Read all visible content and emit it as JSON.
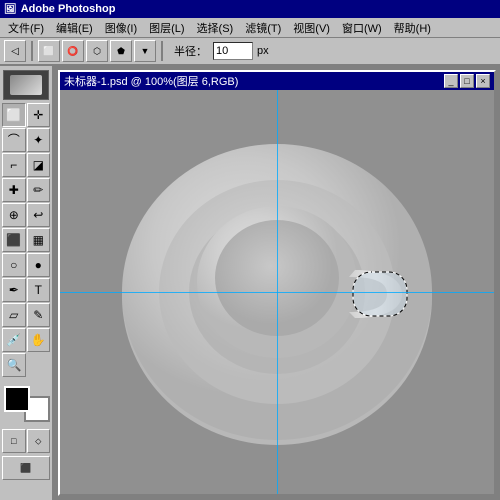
{
  "app": {
    "title": "Adobe Photoshop",
    "icon": "PS"
  },
  "menu": {
    "items": [
      "文件(F)",
      "编辑(E)",
      "图像(I)",
      "图层(L)",
      "选择(S)",
      "滤镜(T)",
      "视图(V)",
      "窗口(W)",
      "帮助(H)"
    ]
  },
  "toolbar": {
    "radius_label": "半径：",
    "radius_value": "10",
    "radius_unit": "px"
  },
  "document": {
    "title": "未标器-1.psd @ 100%(图层 6,RGB)",
    "controls": [
      "_",
      "□",
      "×"
    ]
  },
  "toolbox": {
    "tools": [
      {
        "name": "marquee",
        "icon": "⬜",
        "active": true
      },
      {
        "name": "move",
        "icon": "✛"
      },
      {
        "name": "lasso",
        "icon": "⌒"
      },
      {
        "name": "magic-wand",
        "icon": "✦"
      },
      {
        "name": "crop",
        "icon": "⌐"
      },
      {
        "name": "slice",
        "icon": "⊿"
      },
      {
        "name": "heal",
        "icon": "✚"
      },
      {
        "name": "brush",
        "icon": "✏"
      },
      {
        "name": "stamp",
        "icon": "⊕"
      },
      {
        "name": "history",
        "icon": "↩"
      },
      {
        "name": "eraser",
        "icon": "⬜"
      },
      {
        "name": "gradient",
        "icon": "▦"
      },
      {
        "name": "dodge",
        "icon": "○"
      },
      {
        "name": "pen",
        "icon": "✒"
      },
      {
        "name": "text",
        "icon": "T"
      },
      {
        "name": "shape",
        "icon": "▱"
      },
      {
        "name": "eyedropper",
        "icon": "✎"
      },
      {
        "name": "hand",
        "icon": "✋"
      },
      {
        "name": "zoom",
        "icon": "🔍"
      }
    ],
    "fg_color": "#000000",
    "bg_color": "#ffffff"
  },
  "canvas": {
    "bg_color": "#909090"
  }
}
